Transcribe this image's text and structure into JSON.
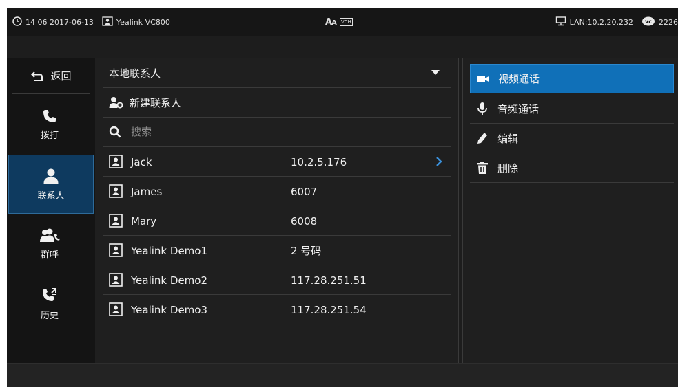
{
  "status_bar": {
    "time_date": "14 06 2017-06-13",
    "device_name": "Yealink VC800",
    "center_icons": [
      "font-size-icon",
      "vch-icon"
    ],
    "center_text": "VCH",
    "network": "LAN:10.2.20.232",
    "account": "2226"
  },
  "left_nav": {
    "back_label": "返回",
    "items": [
      {
        "label": "拨打",
        "icon": "phone-icon",
        "active": false
      },
      {
        "label": "联系人",
        "icon": "person-icon",
        "active": true
      },
      {
        "label": "群呼",
        "icon": "group-icon",
        "active": false
      },
      {
        "label": "历史",
        "icon": "history-icon",
        "active": false
      }
    ]
  },
  "contacts_panel": {
    "group_selected": "本地联系人",
    "new_contact_label": "新建联系人",
    "search_placeholder": "搜索",
    "contacts": [
      {
        "name": "Jack",
        "number": "10.2.5.176",
        "selected": true
      },
      {
        "name": "James",
        "number": "6007",
        "selected": false
      },
      {
        "name": "Mary",
        "number": "6008",
        "selected": false
      },
      {
        "name": "Yealink Demo1",
        "number": "2 号码",
        "selected": false
      },
      {
        "name": "Yealink Demo2",
        "number": "117.28.251.51",
        "selected": false
      },
      {
        "name": "Yealink Demo3",
        "number": "117.28.251.54",
        "selected": false
      }
    ]
  },
  "options_panel": {
    "items": [
      {
        "label": "视频通话",
        "icon": "video-camera-icon",
        "selected": true
      },
      {
        "label": "音频通话",
        "icon": "microphone-icon",
        "selected": false
      },
      {
        "label": "编辑",
        "icon": "pencil-icon",
        "selected": false
      },
      {
        "label": "删除",
        "icon": "trash-icon",
        "selected": false
      }
    ]
  },
  "colors": {
    "background": "#1d1d1d",
    "active_nav": "#0e3a5f",
    "selected_option": "#1070b8",
    "chevron": "#3a8fd8"
  }
}
